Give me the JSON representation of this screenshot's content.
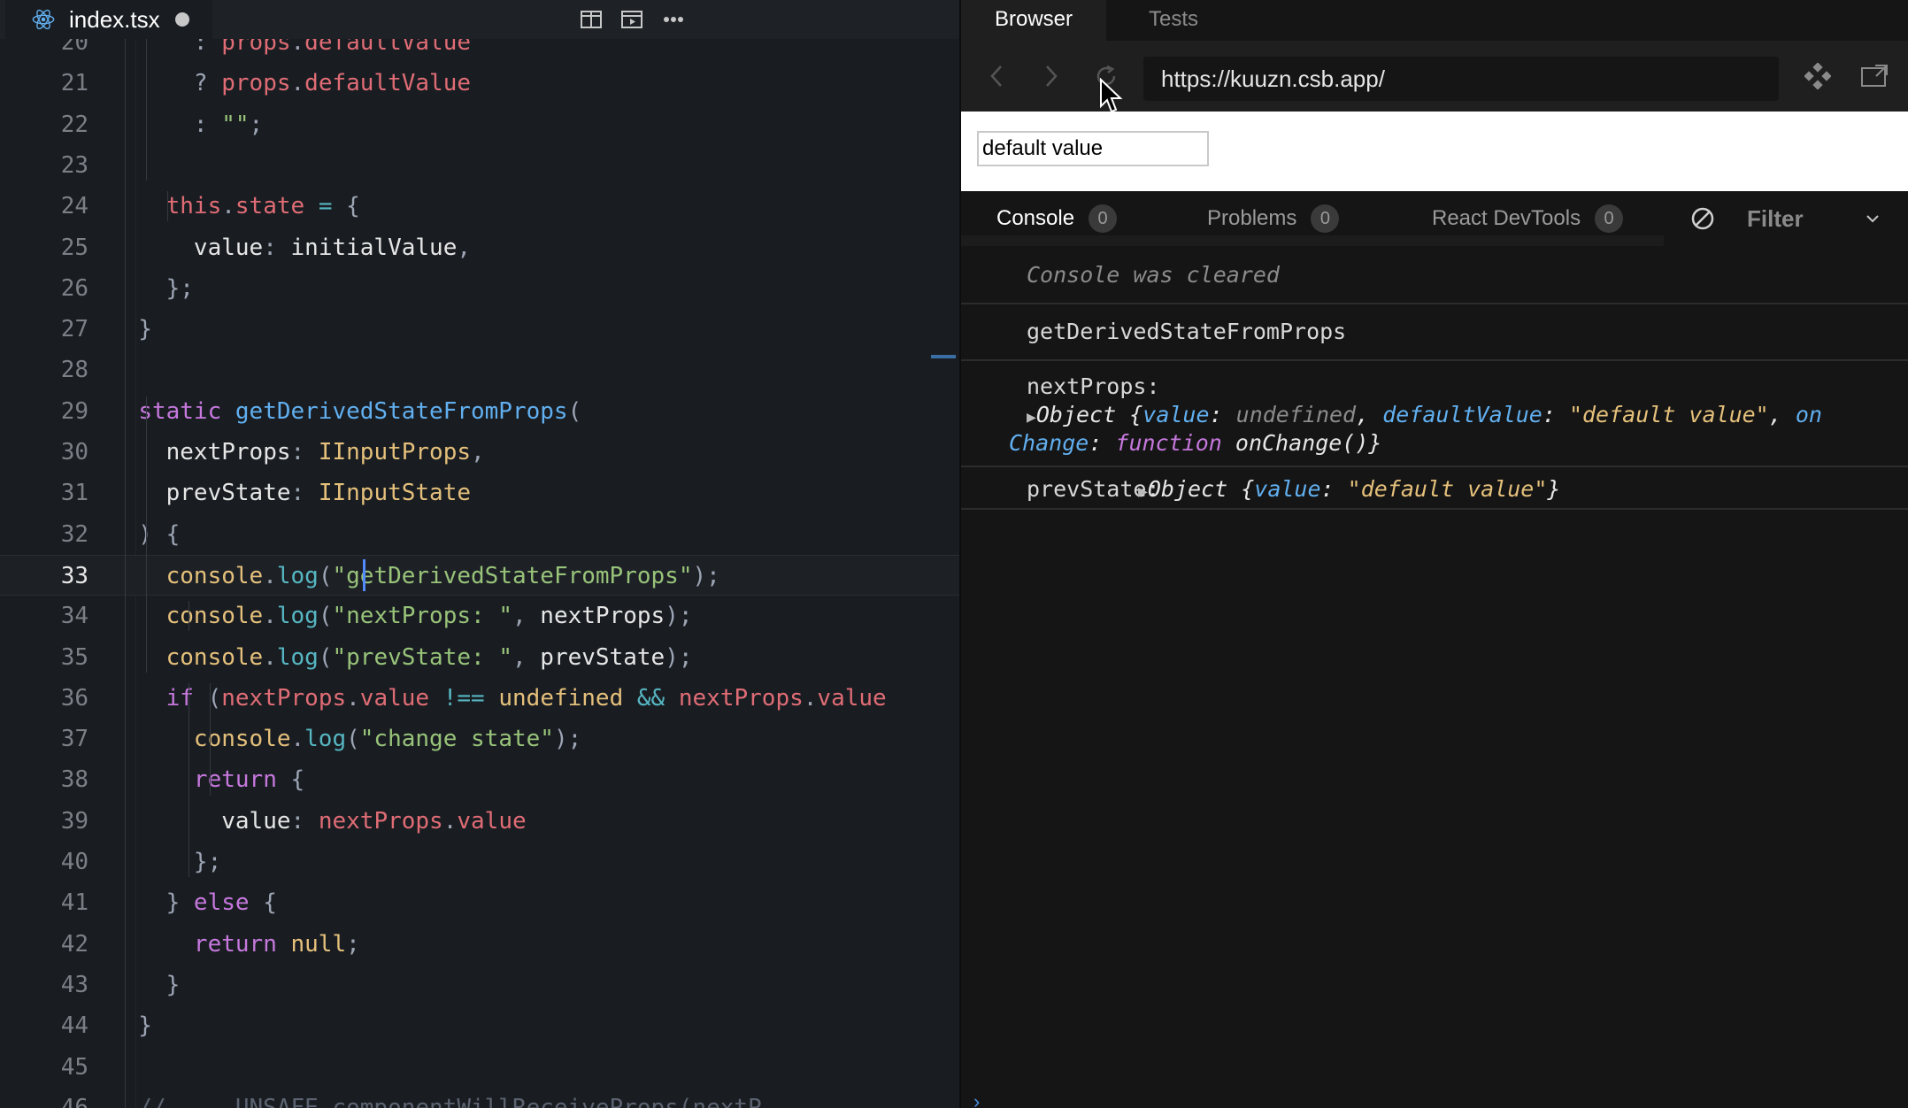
{
  "editor": {
    "tab": {
      "filename": "index.tsx",
      "icon": "react-icon",
      "modified": true
    },
    "toolbar": {
      "icons": [
        "split-editor-icon",
        "preview-icon",
        "more-icon"
      ]
    },
    "active_line": 33,
    "lines": [
      {
        "n": "20",
        "t": [
          [
            "pu",
            "      : "
          ],
          [
            "pr",
            "props"
          ],
          [
            "pu",
            "."
          ],
          [
            "pr",
            "defaultValue"
          ]
        ]
      },
      {
        "n": "21",
        "t": [
          [
            "pu",
            "      ? "
          ],
          [
            "pr",
            "props"
          ],
          [
            "pu",
            "."
          ],
          [
            "pr",
            "defaultValue"
          ]
        ]
      },
      {
        "n": "22",
        "t": [
          [
            "pu",
            "      : "
          ],
          [
            "str",
            "\"\""
          ],
          [
            "pu",
            ";"
          ]
        ]
      },
      {
        "n": "23",
        "t": []
      },
      {
        "n": "24",
        "t": [
          [
            "pu",
            "    "
          ],
          [
            "pr",
            "this"
          ],
          [
            "pu",
            "."
          ],
          [
            "pr",
            "state"
          ],
          [
            "pu",
            " "
          ],
          [
            "op",
            "="
          ],
          [
            "pu",
            " {"
          ]
        ]
      },
      {
        "n": "25",
        "t": [
          [
            "pu",
            "      "
          ],
          [
            "df",
            "value"
          ],
          [
            "pu",
            ": "
          ],
          [
            "df",
            "initialValue"
          ],
          [
            "pu",
            ","
          ]
        ]
      },
      {
        "n": "26",
        "t": [
          [
            "pu",
            "    };"
          ]
        ]
      },
      {
        "n": "27",
        "t": [
          [
            "pu",
            "  }"
          ]
        ]
      },
      {
        "n": "28",
        "t": []
      },
      {
        "n": "29",
        "t": [
          [
            "pu",
            "  "
          ],
          [
            "kw",
            "static"
          ],
          [
            "pu",
            " "
          ],
          [
            "fn",
            "getDerivedStateFromProps"
          ],
          [
            "pu",
            "("
          ]
        ]
      },
      {
        "n": "30",
        "t": [
          [
            "pu",
            "    "
          ],
          [
            "df",
            "nextProps"
          ],
          [
            "pu",
            ": "
          ],
          [
            "ty",
            "IInputProps"
          ],
          [
            "pu",
            ","
          ]
        ]
      },
      {
        "n": "31",
        "t": [
          [
            "pu",
            "    "
          ],
          [
            "df",
            "prevState"
          ],
          [
            "pu",
            ": "
          ],
          [
            "ty",
            "IInputState"
          ]
        ]
      },
      {
        "n": "32",
        "t": [
          [
            "pu",
            "  ) {"
          ]
        ]
      },
      {
        "n": "33",
        "t": [
          [
            "pu",
            "    "
          ],
          [
            "ty",
            "console"
          ],
          [
            "pu",
            "."
          ],
          [
            "mt",
            "log"
          ],
          [
            "pu",
            "("
          ],
          [
            "str",
            "\"getDerivedStateFromProps\""
          ],
          [
            "pu",
            ");"
          ]
        ]
      },
      {
        "n": "34",
        "t": [
          [
            "pu",
            "    "
          ],
          [
            "ty",
            "console"
          ],
          [
            "pu",
            "."
          ],
          [
            "mt",
            "log"
          ],
          [
            "pu",
            "("
          ],
          [
            "str",
            "\"nextProps: \""
          ],
          [
            "pu",
            ", "
          ],
          [
            "df",
            "nextProps"
          ],
          [
            "pu",
            ");"
          ]
        ]
      },
      {
        "n": "35",
        "t": [
          [
            "pu",
            "    "
          ],
          [
            "ty",
            "console"
          ],
          [
            "pu",
            "."
          ],
          [
            "mt",
            "log"
          ],
          [
            "pu",
            "("
          ],
          [
            "str",
            "\"prevState: \""
          ],
          [
            "pu",
            ", "
          ],
          [
            "df",
            "prevState"
          ],
          [
            "pu",
            ");"
          ]
        ]
      },
      {
        "n": "36",
        "t": [
          [
            "pu",
            "    "
          ],
          [
            "kw",
            "if"
          ],
          [
            "pu",
            " ("
          ],
          [
            "pr",
            "nextProps"
          ],
          [
            "pu",
            "."
          ],
          [
            "pr",
            "value"
          ],
          [
            "pu",
            " "
          ],
          [
            "op",
            "!=="
          ],
          [
            "pu",
            " "
          ],
          [
            "ty",
            "undefined"
          ],
          [
            "pu",
            " "
          ],
          [
            "op",
            "&&"
          ],
          [
            "pu",
            " "
          ],
          [
            "pr",
            "nextProps"
          ],
          [
            "pu",
            "."
          ],
          [
            "pr",
            "value"
          ]
        ]
      },
      {
        "n": "37",
        "t": [
          [
            "pu",
            "      "
          ],
          [
            "ty",
            "console"
          ],
          [
            "pu",
            "."
          ],
          [
            "mt",
            "log"
          ],
          [
            "pu",
            "("
          ],
          [
            "str",
            "\"change state\""
          ],
          [
            "pu",
            ");"
          ]
        ]
      },
      {
        "n": "38",
        "t": [
          [
            "pu",
            "      "
          ],
          [
            "kw",
            "return"
          ],
          [
            "pu",
            " {"
          ]
        ]
      },
      {
        "n": "39",
        "t": [
          [
            "pu",
            "        "
          ],
          [
            "df",
            "value"
          ],
          [
            "pu",
            ": "
          ],
          [
            "pr",
            "nextProps"
          ],
          [
            "pu",
            "."
          ],
          [
            "pr",
            "value"
          ]
        ]
      },
      {
        "n": "40",
        "t": [
          [
            "pu",
            "      };"
          ]
        ]
      },
      {
        "n": "41",
        "t": [
          [
            "pu",
            "    } "
          ],
          [
            "kw",
            "else"
          ],
          [
            "pu",
            " {"
          ]
        ]
      },
      {
        "n": "42",
        "t": [
          [
            "pu",
            "      "
          ],
          [
            "kw",
            "return"
          ],
          [
            "pu",
            " "
          ],
          [
            "ty",
            "null"
          ],
          [
            "pu",
            ";"
          ]
        ]
      },
      {
        "n": "43",
        "t": [
          [
            "pu",
            "    }"
          ]
        ]
      },
      {
        "n": "44",
        "t": [
          [
            "pu",
            "  }"
          ]
        ]
      },
      {
        "n": "45",
        "t": []
      },
      {
        "n": "46",
        "t": [
          [
            "cm",
            "  // ... UNSAFE_componentWillReceiveProps(nextP"
          ]
        ]
      }
    ]
  },
  "right_panel": {
    "tabs": [
      {
        "label": "Browser",
        "active": true
      },
      {
        "label": "Tests",
        "active": false
      }
    ],
    "nav": {
      "url": "https://kuuzn.csb.app/"
    },
    "preview": {
      "input_value": "default value"
    },
    "devtools": {
      "tabs": [
        {
          "label": "Console",
          "count": "0"
        },
        {
          "label": "Problems",
          "count": "0"
        },
        {
          "label": "React DevTools",
          "count": "0"
        }
      ],
      "filter_label": "Filter"
    },
    "console": {
      "cleared": "Console was cleared",
      "log1": "getDerivedStateFromProps",
      "log2_label": "nextProps:",
      "log2_obj": {
        "prefix": "Object {",
        "k1": "value",
        "v1": "undefined",
        "k2": "defaultValue",
        "v2": "\"default value\"",
        "k3a": "on",
        "k3b": "Change",
        "v3kw": "function",
        "v3": "onChange()}"
      },
      "log3_label": "prevState:",
      "log3_obj": {
        "prefix": "Object {",
        "k1": "value",
        "v1": "\"default value\"",
        "suffix": "}"
      }
    }
  },
  "colors": {
    "accent": "#528bff",
    "keyword": "#c678dd",
    "function": "#61afef",
    "string": "#98c379",
    "type": "#e5c07b",
    "property": "#e06c75"
  }
}
